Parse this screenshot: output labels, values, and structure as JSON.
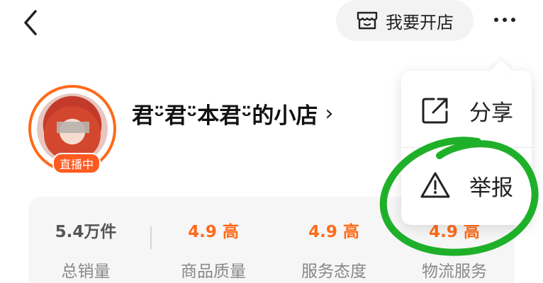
{
  "header": {
    "open_store_label": "我要开店",
    "icons": {
      "back": "chevron-left-icon",
      "store": "storefront-icon",
      "more": "more-dots-icon"
    }
  },
  "shop": {
    "name": "君ᵕ̈君ᵕ̈本君ᵕ̈的小店",
    "chevron": "›",
    "live_badge": "直播中"
  },
  "stats": [
    {
      "value": "5.4万件",
      "label": "总销量"
    },
    {
      "value": "4.9 高",
      "label": "商品质量"
    },
    {
      "value": "4.9 高",
      "label": "服务态度"
    },
    {
      "value": "4.9 高",
      "label": "物流服务"
    }
  ],
  "menu": {
    "items": [
      {
        "label": "分享",
        "icon": "share-icon"
      },
      {
        "label": "举报",
        "icon": "warning-icon"
      }
    ]
  },
  "colors": {
    "accent": "#ff6a1a",
    "annotation": "#1fb02a"
  }
}
